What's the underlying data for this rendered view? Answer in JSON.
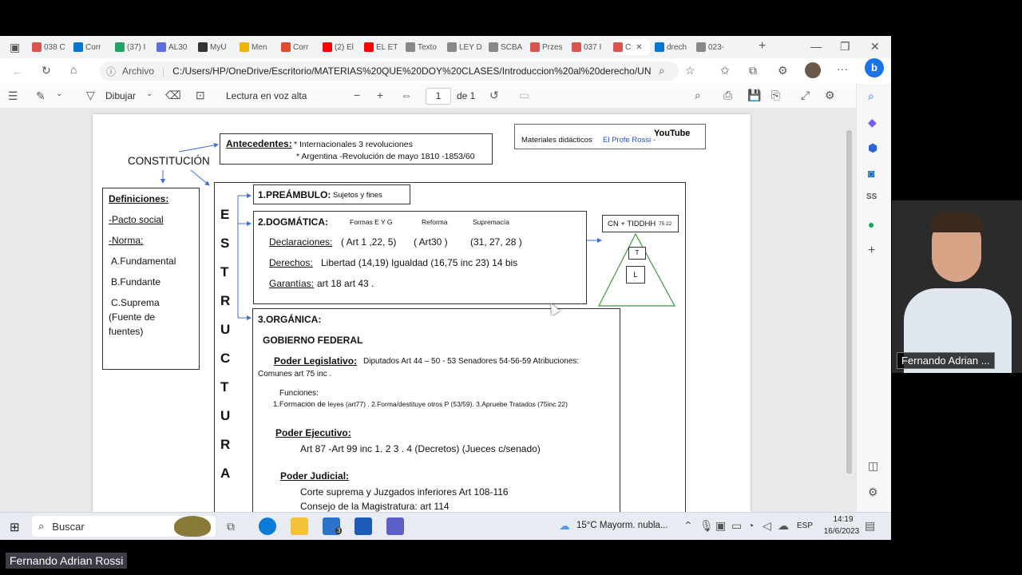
{
  "tabs": [
    {
      "label": "038 C",
      "color": "#d9534f"
    },
    {
      "label": "Corr",
      "color": "#0078d4"
    },
    {
      "label": "(37) I",
      "color": "#1fa463"
    },
    {
      "label": "AL30",
      "color": "#5b6ee1"
    },
    {
      "label": "MyU",
      "color": "#333333",
      "badge": "UP"
    },
    {
      "label": "Men",
      "color": "#f0b400"
    },
    {
      "label": "Corr",
      "color": "#e04b2f",
      "badge": "W"
    },
    {
      "label": "(2) El",
      "color": "#ff0000"
    },
    {
      "label": "EL ET",
      "color": "#ff0000"
    },
    {
      "label": "Texto",
      "color": "#888888"
    },
    {
      "label": "LEY D",
      "color": "#888888"
    },
    {
      "label": "SCBA",
      "color": "#888888"
    },
    {
      "label": "Przes",
      "color": "#d9534f"
    },
    {
      "label": "037 I",
      "color": "#d9534f"
    },
    {
      "label": "C",
      "color": "#d9534f",
      "active": true
    },
    {
      "label": "drech",
      "color": "#0078d4"
    },
    {
      "label": "023-",
      "color": "#888888"
    }
  ],
  "address": {
    "site_label": "Archivo",
    "url": "C:/Users/HP/OneDrive/Escritorio/MATERIAS%20QUE%20DOY%20CLASES/Introduccion%20al%20derecho/UNIDAD%2..."
  },
  "pdf_toolbar": {
    "draw_label": "Dibujar",
    "read_aloud_label": "Lectura en voz alta",
    "page_current": "1",
    "page_total": "de 1"
  },
  "doc": {
    "constitucion": "CONSTITUCIÓN",
    "antecedentes_label": "Antecedentes:",
    "antecedentes_line1": "* Internacionales 3 revoluciones",
    "antecedentes_line2": "* Argentina -Revolución de mayo 1810 -1853/60",
    "materiales": "Materiales didácticos",
    "profe": "El Profe Rossi -",
    "youtube": "YouTube",
    "definiciones": "Definiciones:",
    "pacto": "-Pacto social",
    "norma": "-Norma:",
    "fundamental": "A.Fundamental",
    "fundante": "B.Fundante",
    "suprema1": "C.Suprema",
    "suprema2": "(Fuente de",
    "suprema3": "fuentes)",
    "estructura": [
      "E",
      "S",
      "T",
      "R",
      "U",
      "C",
      "T",
      "U",
      "R",
      "A"
    ],
    "preambulo_label": "1.PREÁMBULO:",
    "preambulo_text": "Sujetos y fines",
    "dogmatica_label": "2.DOGMÁTICA:",
    "formas": "Formas E Y G",
    "reforma": "Reforma",
    "supremacia": "Supremacía",
    "declaraciones_label": "Declaraciones:",
    "decl_1": "( Art 1 ,22, 5)",
    "decl_2": "( Art30 )",
    "decl_3": "(31, 27, 28 )",
    "derechos_label": "Derechos:",
    "derechos_text": "Libertad (14,19)     Igualdad (16,75 inc 23) 14 bis",
    "garantias_label": "Garantías:",
    "garantias_text": "art 18   art 43 .",
    "cn": "CN + TIDDHH",
    "cn_small": "75 22",
    "tri_t": "T",
    "tri_l": "L",
    "organica_label": "3.ORGÁNICA:",
    "gobierno": "GOBIERNO FEDERAL",
    "legislativo_label": "Poder Legislativo:",
    "legislativo_text": "Diputados Art 44 – 50 - 53       Senadores 54-56-59   Atribuciones:",
    "comunes": "Comunes art 75 inc .",
    "funciones": "Funciones:",
    "funciones_text_a": "1.Formación de ",
    "funciones_text_b": "leyes (art77) .  2.Forma/destituye otros P (53/59). 3.Apruebe Tratados (75inc 22)",
    "ejecutivo_label": "Poder Ejecutivo:",
    "ejecutivo_text": "Art 87 -Art 99 inc 1. 2 3 . 4    (Decretos)   (Jueces c/senado)",
    "judicial_label": "Poder Judicial:",
    "judicial_text1": "Corte suprema y Juzgados inferiores Art 108-116",
    "judicial_text2": "Consejo de la Magistratura: art 114"
  },
  "taskbar": {
    "search_placeholder": "Buscar",
    "weather": "15°C  Mayorm. nubla...",
    "lang": "ESP",
    "time": "14:19",
    "date": "16/6/2023",
    "mail_badge": "3"
  },
  "video": {
    "name_overlay": "Fernando Adrian ..."
  },
  "meeting": {
    "presenter_name": "Fernando Adrian Rossi"
  }
}
